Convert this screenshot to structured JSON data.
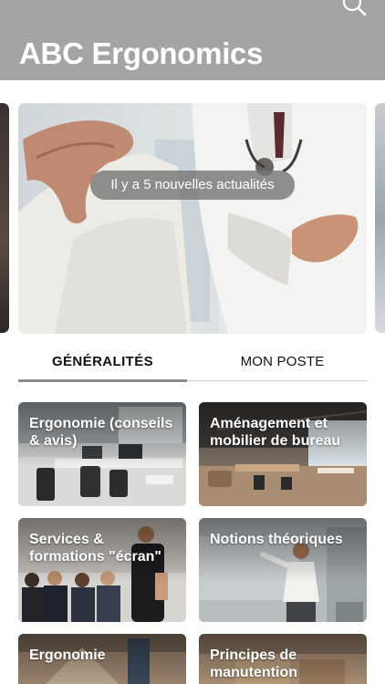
{
  "header": {
    "title": "ABC Ergonomics",
    "search_icon": "search-icon",
    "background_color": "#a4a4a4"
  },
  "carousel": {
    "news_banner": "Il y a 5 nouvelles actualités"
  },
  "tabs": [
    {
      "label": "GÉNÉRALITÉS",
      "active": true
    },
    {
      "label": "MON POSTE",
      "active": false
    }
  ],
  "categories": [
    {
      "title": "Ergonomie (conseils & avis)"
    },
    {
      "title": "Aménagement et mobilier de bureau"
    },
    {
      "title": "Services & formations \"écran\""
    },
    {
      "title": "Notions théoriques"
    },
    {
      "title": "Ergonomie"
    },
    {
      "title": "Principes de manutention"
    }
  ]
}
